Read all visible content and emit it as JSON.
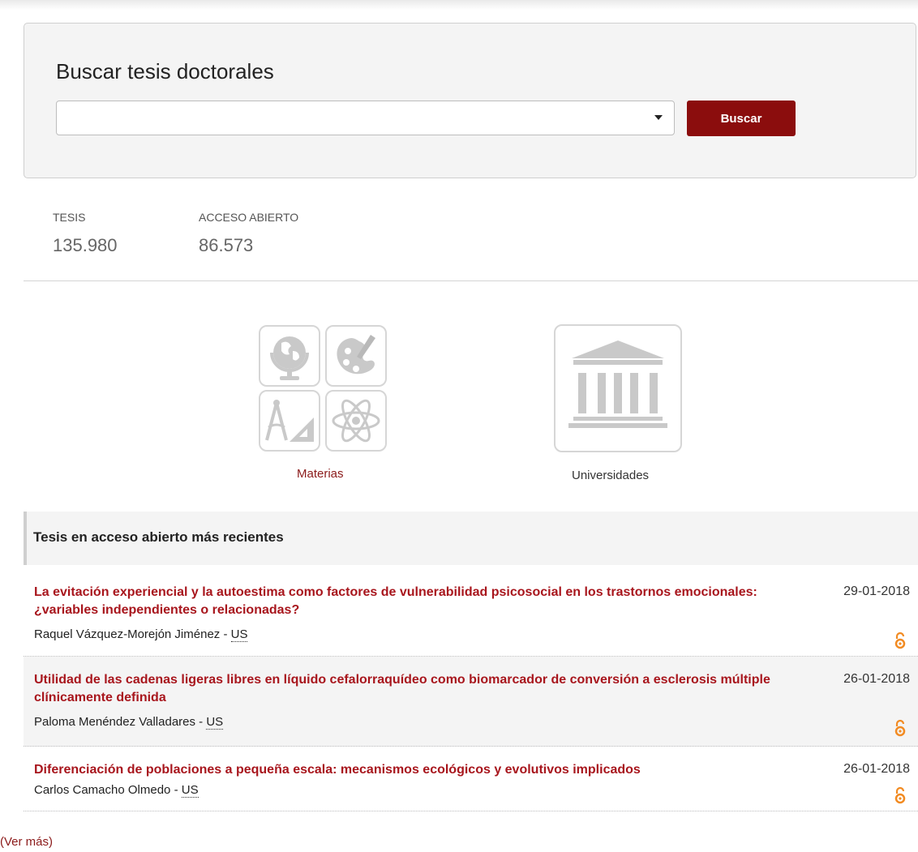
{
  "search": {
    "title": "Buscar tesis doctorales",
    "select_value": "",
    "button_label": "Buscar"
  },
  "stats": {
    "tesis_label": "TESIS",
    "tesis_value": "135.980",
    "abierto_label": "ACCESO ABIERTO",
    "abierto_value": "86.573"
  },
  "categories": {
    "materias_label": "Materias",
    "universidades_label": "Universidades",
    "materias_icons": [
      "globe-icon",
      "palette-icon",
      "geometry-tools-icon",
      "atom-icon"
    ],
    "universidades_icon": "university-building-icon"
  },
  "recent": {
    "title": "Tesis en acceso abierto más recientes",
    "items": [
      {
        "title": "La evitación experiencial y la autoestima como factores de vulnerabilidad psicosocial en los trastornos emocionales: ¿variables independientes o relacionadas?",
        "author": "Raquel Vázquez-Morejón Jiménez - ",
        "university": "US",
        "date": "29-01-2018",
        "icon": "open-access-icon"
      },
      {
        "title": "Utilidad de las cadenas ligeras libres en líquido cefalorraquídeo como biomarcador de conversión a esclerosis múltiple clínicamente definida",
        "author": "Paloma Menéndez Valladares - ",
        "university": "US",
        "date": "26-01-2018",
        "icon": "open-access-icon"
      },
      {
        "title": "Diferenciación de poblaciones a pequeña escala: mecanismos ecológicos y evolutivos implicados",
        "author": "Carlos Camacho Olmedo - ",
        "university": "US",
        "date": "26-01-2018",
        "icon": "open-access-icon"
      }
    ],
    "more_label": "(Ver más)"
  },
  "colors": {
    "accent": "#8b0d0d",
    "title_red": "#a8161d",
    "open_access": "#f28b22"
  }
}
